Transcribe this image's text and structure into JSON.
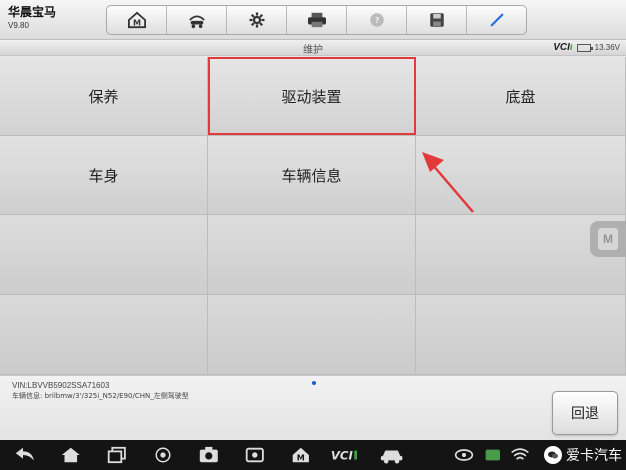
{
  "header": {
    "title": "华晨宝马",
    "version": "V9.80"
  },
  "toolbar": {
    "buttons": [
      {
        "icon": "home-icon"
      },
      {
        "icon": "car-lift-icon"
      },
      {
        "icon": "gear-icon"
      },
      {
        "icon": "printer-icon"
      },
      {
        "icon": "help-icon"
      },
      {
        "icon": "save-icon"
      },
      {
        "icon": "pen-icon"
      }
    ]
  },
  "subheader": {
    "title": "维护",
    "vci": "VCI",
    "voltage": "13.36V"
  },
  "menu": {
    "items": [
      "保养",
      "驱动装置",
      "底盘",
      "车身",
      "车辆信息"
    ]
  },
  "info": {
    "vin": "VIN:LBVVB5902SSA71603",
    "vehicle": "车辆信息: brilbmw/3'/325i_N52/E90/CHN_左侧驾驶型"
  },
  "actions": {
    "back_label": "回退"
  },
  "watermark": {
    "text": "爱卡汽车"
  },
  "colors": {
    "highlight": "#e23a3a",
    "vci_accent": "#3aa53a"
  }
}
